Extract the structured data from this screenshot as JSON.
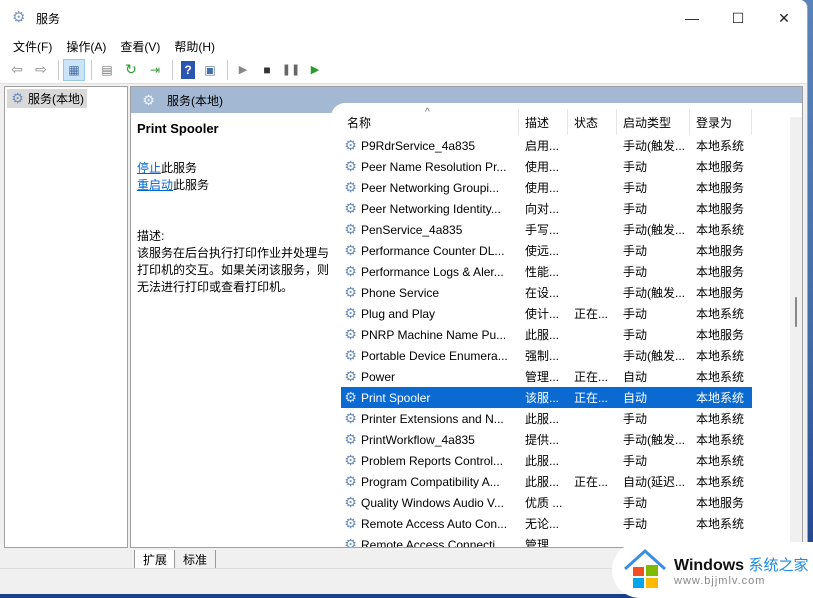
{
  "window": {
    "title": "服务",
    "controls": {
      "minimize": "—",
      "maximize": "☐",
      "close": "✕"
    }
  },
  "menu": [
    "文件(F)",
    "操作(A)",
    "查看(V)",
    "帮助(H)"
  ],
  "toolbar": {
    "icons": [
      "back-icon",
      "forward-icon",
      "show-hide-tree-icon",
      "properties-icon",
      "refresh-icon",
      "export-icon",
      "help-icon",
      "console-view-icon",
      "start-icon",
      "stop-icon",
      "pause-icon",
      "resume-icon"
    ]
  },
  "tree": {
    "root": "服务(本地)"
  },
  "content": {
    "header": "服务(本地)",
    "selected_service": "Print Spooler",
    "actions": [
      {
        "link": "停止",
        "suffix": "此服务"
      },
      {
        "link": "重启动",
        "suffix": "此服务"
      }
    ],
    "description_label": "描述:",
    "description": "该服务在后台执行打印作业并处理与打印机的交互。如果关闭该服务，则无法进行打印或查看打印机。"
  },
  "list": {
    "columns": [
      "名称",
      "描述",
      "状态",
      "启动类型",
      "登录为"
    ],
    "sort_indicator": "^",
    "rows": [
      {
        "name": "P9RdrService_4a835",
        "desc": "启用...",
        "status": "",
        "startup": "手动(触发...",
        "logon": "本地系统"
      },
      {
        "name": "Peer Name Resolution Pr...",
        "desc": "使用...",
        "status": "",
        "startup": "手动",
        "logon": "本地服务"
      },
      {
        "name": "Peer Networking Groupi...",
        "desc": "使用...",
        "status": "",
        "startup": "手动",
        "logon": "本地服务"
      },
      {
        "name": "Peer Networking Identity...",
        "desc": "向对...",
        "status": "",
        "startup": "手动",
        "logon": "本地服务"
      },
      {
        "name": "PenService_4a835",
        "desc": "手写...",
        "status": "",
        "startup": "手动(触发...",
        "logon": "本地系统"
      },
      {
        "name": "Performance Counter DL...",
        "desc": "使远...",
        "status": "",
        "startup": "手动",
        "logon": "本地服务"
      },
      {
        "name": "Performance Logs & Aler...",
        "desc": "性能...",
        "status": "",
        "startup": "手动",
        "logon": "本地服务"
      },
      {
        "name": "Phone Service",
        "desc": "在设...",
        "status": "",
        "startup": "手动(触发...",
        "logon": "本地服务"
      },
      {
        "name": "Plug and Play",
        "desc": "使计...",
        "status": "正在...",
        "startup": "手动",
        "logon": "本地系统"
      },
      {
        "name": "PNRP Machine Name Pu...",
        "desc": "此服...",
        "status": "",
        "startup": "手动",
        "logon": "本地服务"
      },
      {
        "name": "Portable Device Enumera...",
        "desc": "强制...",
        "status": "",
        "startup": "手动(触发...",
        "logon": "本地系统"
      },
      {
        "name": "Power",
        "desc": "管理...",
        "status": "正在...",
        "startup": "自动",
        "logon": "本地系统"
      },
      {
        "name": "Print Spooler",
        "desc": "该服...",
        "status": "正在...",
        "startup": "自动",
        "logon": "本地系统",
        "selected": true
      },
      {
        "name": "Printer Extensions and N...",
        "desc": "此服...",
        "status": "",
        "startup": "手动",
        "logon": "本地系统"
      },
      {
        "name": "PrintWorkflow_4a835",
        "desc": "提供...",
        "status": "",
        "startup": "手动(触发...",
        "logon": "本地系统"
      },
      {
        "name": "Problem Reports Control...",
        "desc": "此服...",
        "status": "",
        "startup": "手动",
        "logon": "本地系统"
      },
      {
        "name": "Program Compatibility A...",
        "desc": "此服...",
        "status": "正在...",
        "startup": "自动(延迟...",
        "logon": "本地系统"
      },
      {
        "name": "Quality Windows Audio V...",
        "desc": "优质 ...",
        "status": "",
        "startup": "手动",
        "logon": "本地服务"
      },
      {
        "name": "Remote Access Auto Con...",
        "desc": "无论...",
        "status": "",
        "startup": "手动",
        "logon": "本地系统"
      },
      {
        "name": "Remote Access Connecti...",
        "desc": "管理...",
        "status": "",
        "startup": "",
        "logon": ""
      }
    ]
  },
  "tabs": [
    "扩展",
    "标准"
  ],
  "watermark": {
    "brand": "Windows",
    "cn": "系统之家",
    "url": "www.bjjmlv.com"
  },
  "colors": {
    "selection": "#0a6ad2",
    "header": "#a3b8d3",
    "link": "#0066cc"
  }
}
